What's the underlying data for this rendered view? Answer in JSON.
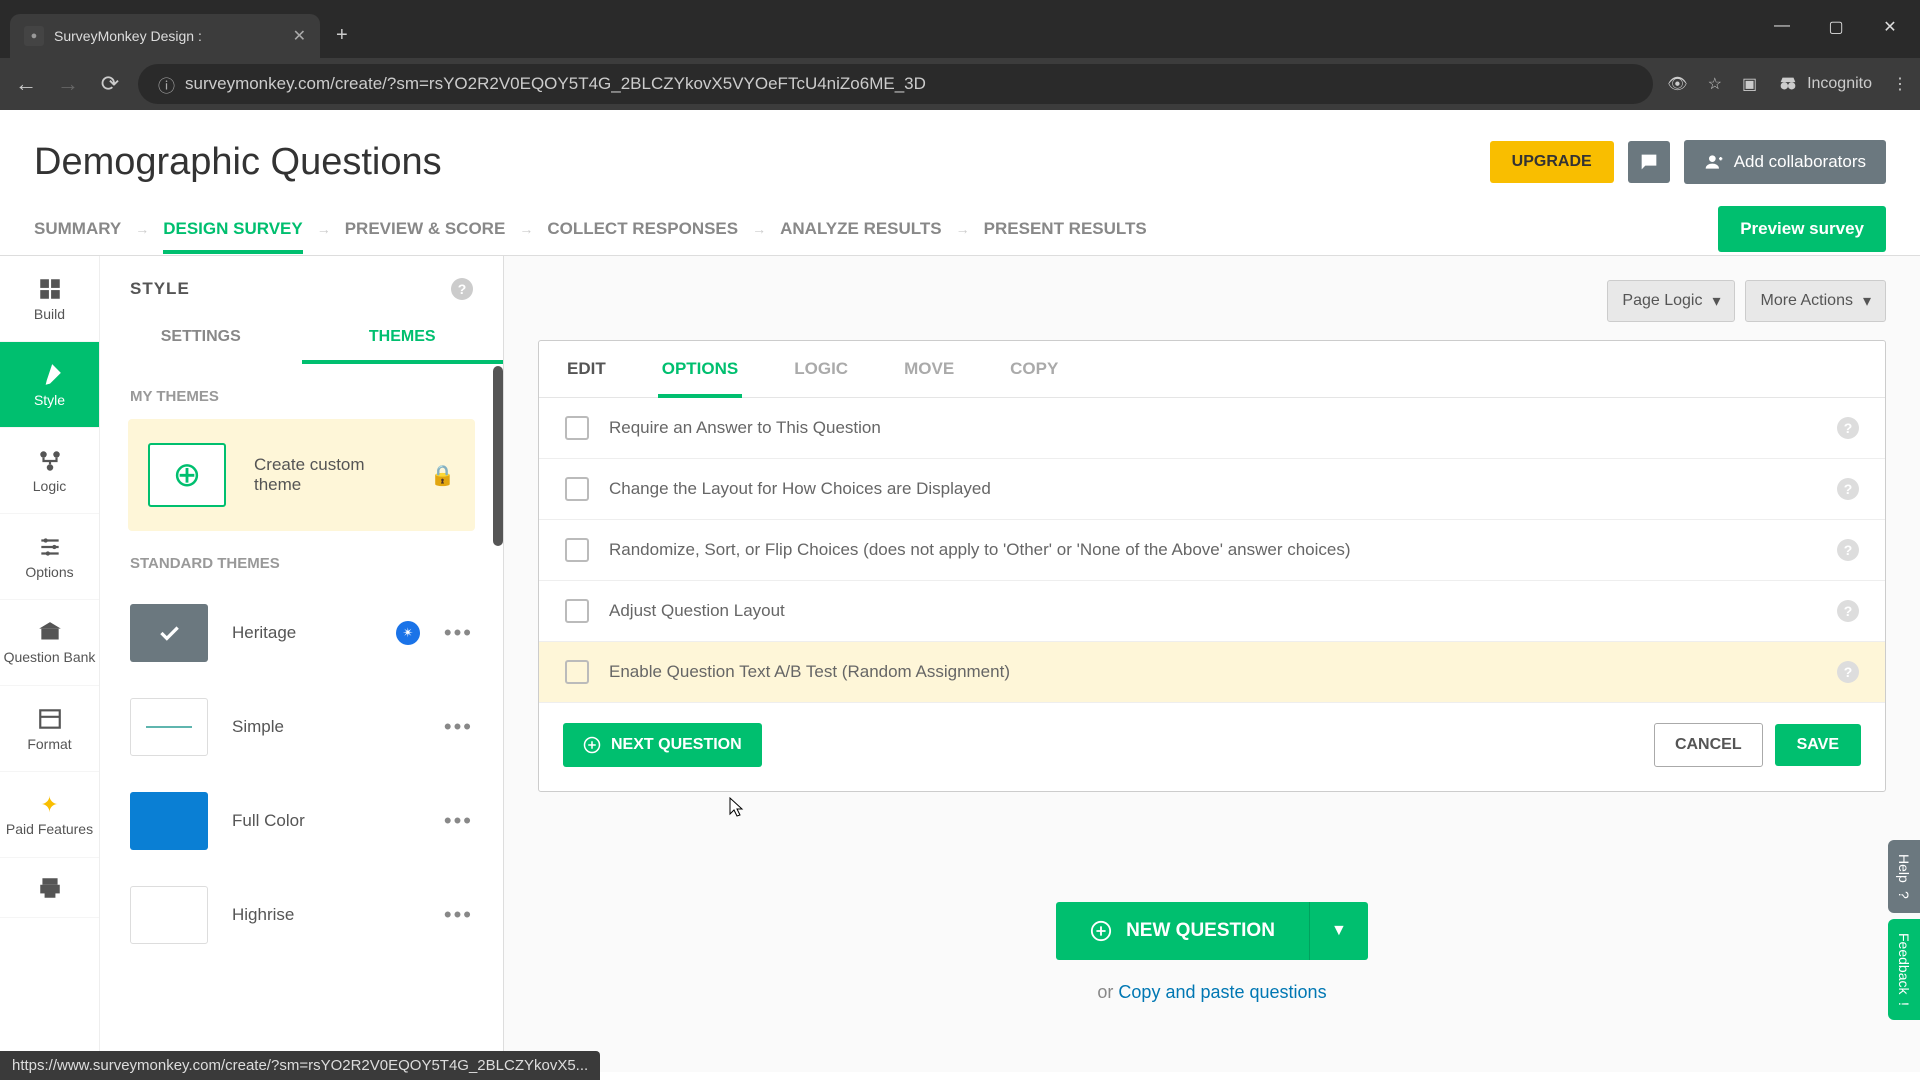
{
  "browser": {
    "tab_title": "SurveyMonkey Design :",
    "url": "surveymonkey.com/create/?sm=rsYO2R2V0EQOY5T4G_2BLCZYkovX5VYOeFTcU4niZo6ME_3D",
    "incognito": "Incognito",
    "status_bar": "https://www.surveymonkey.com/create/?sm=rsYO2R2V0EQOY5T4G_2BLCZYkovX5..."
  },
  "header": {
    "title": "Demographic Questions",
    "upgrade": "UPGRADE",
    "collaborators": "Add collaborators"
  },
  "nav": {
    "items": [
      "SUMMARY",
      "DESIGN SURVEY",
      "PREVIEW & SCORE",
      "COLLECT RESPONSES",
      "ANALYZE RESULTS",
      "PRESENT RESULTS"
    ],
    "active_index": 1,
    "preview": "Preview survey"
  },
  "rail": {
    "items": [
      "Build",
      "Style",
      "Logic",
      "Options",
      "Question Bank",
      "Format",
      "Paid Features"
    ],
    "active_index": 1
  },
  "style_panel": {
    "title": "STYLE",
    "tabs": [
      "SETTINGS",
      "THEMES"
    ],
    "active_tab": 1,
    "my_themes": "MY THEMES",
    "create": "Create custom theme",
    "standard_themes": "STANDARD THEMES",
    "themes": [
      "Heritage",
      "Simple",
      "Full Color",
      "Highrise"
    ]
  },
  "canvas_toolbar": {
    "page_logic": "Page Logic",
    "more_actions": "More Actions"
  },
  "card": {
    "tabs": [
      "EDIT",
      "OPTIONS",
      "LOGIC",
      "MOVE",
      "COPY"
    ],
    "active_index": 1,
    "options": [
      "Require an Answer to This Question",
      "Change the Layout for How Choices are Displayed",
      "Randomize, Sort, or Flip Choices (does not apply to 'Other' or 'None of the Above' answer choices)",
      "Adjust Question Layout",
      "Enable Question Text A/B Test (Random Assignment)"
    ],
    "next": "NEXT QUESTION",
    "cancel": "CANCEL",
    "save": "SAVE"
  },
  "newq": {
    "label": "NEW QUESTION",
    "or": "or ",
    "copy": "Copy and paste questions"
  },
  "side": {
    "help": "Help",
    "feedback": "Feedback"
  }
}
